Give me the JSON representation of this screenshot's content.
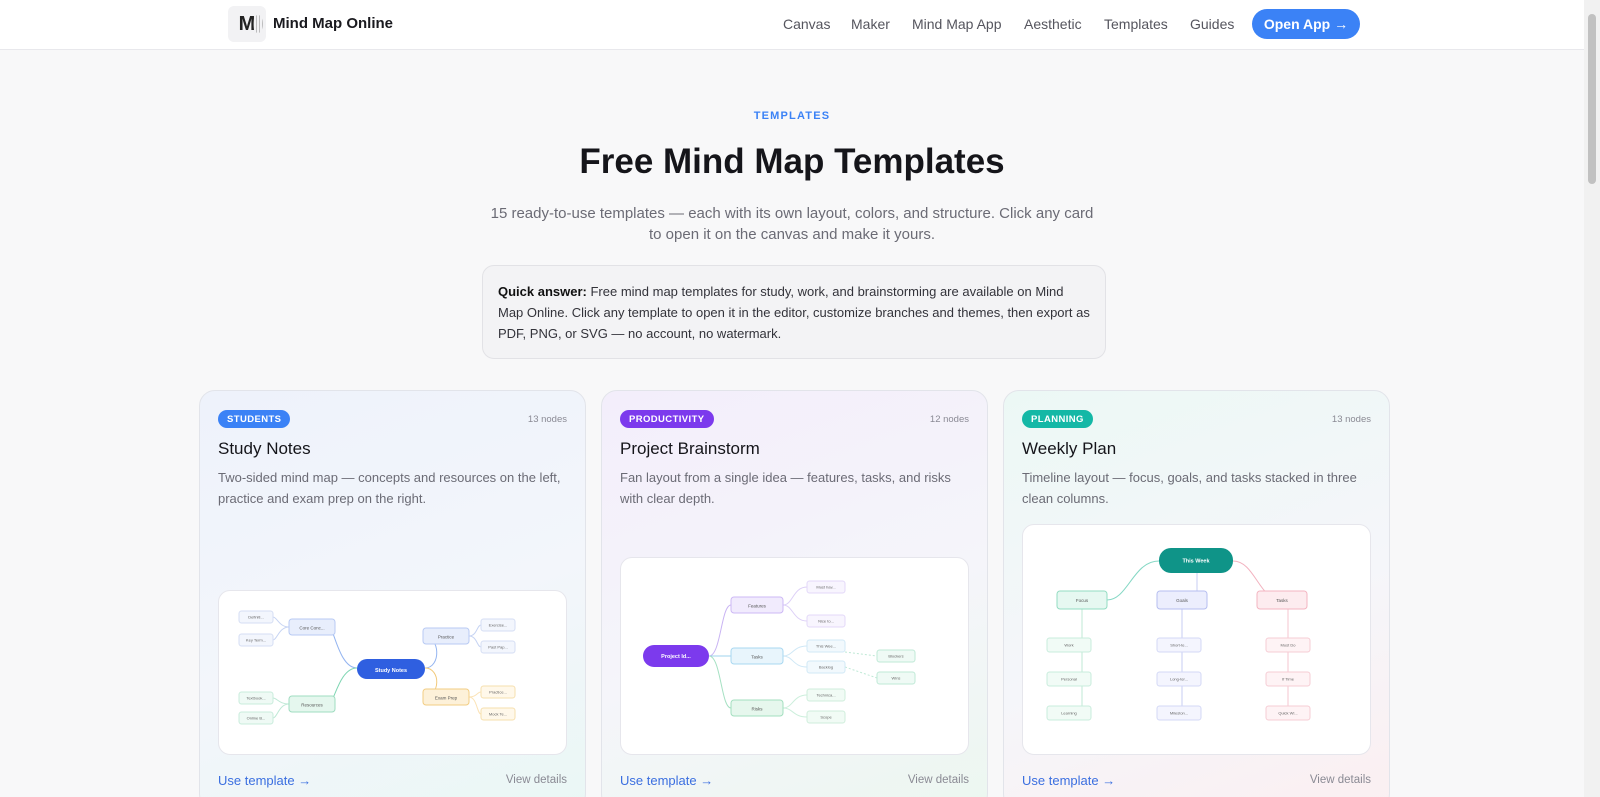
{
  "brand": {
    "logo_letter": "M",
    "name": "Mind Map Online"
  },
  "nav": {
    "links": [
      "Canvas",
      "Maker",
      "Mind Map App",
      "Aesthetic",
      "Templates",
      "Guides"
    ],
    "cta": "Open App →"
  },
  "hero": {
    "eyebrow": "TEMPLATES",
    "title": "Free Mind Map Templates",
    "subtitle": "15 ready-to-use templates — each with its own layout, colors, and structure. Click any card to open it on the canvas and make it yours."
  },
  "quick_answer": {
    "label": "Quick answer:",
    "text": " Free mind map templates for study, work, and brainstorming are available on Mind Map Online. Click any template to open it in the editor, customize branches and themes, then export as PDF, PNG, or SVG — no account, no watermark."
  },
  "cards": [
    {
      "badge": "STUDENTS",
      "badge_color": "#3b82f6",
      "nodes": "13 nodes",
      "title": "Study Notes",
      "desc": "Two-sided mind map — concepts and resources on the left, practice and exam prep on the right.",
      "use": "Use template →",
      "details": "View details",
      "preview": {
        "center": "Study Notes",
        "branches": [
          "Core Conc...",
          "Practice",
          "Resources",
          "Exam Prep"
        ],
        "leaves": [
          "Definiti...",
          "Key Term...",
          "Exercise...",
          "Past Pap...",
          "Textbook...",
          "Online B...",
          "Practice...",
          "Mock Te..."
        ]
      }
    },
    {
      "badge": "PRODUCTIVITY",
      "badge_color": "#7c3aed",
      "nodes": "12 nodes",
      "title": "Project Brainstorm",
      "desc": "Fan layout from a single idea — features, tasks, and risks with clear depth.",
      "use": "Use template →",
      "details": "View details",
      "preview": {
        "center": "Project Id...",
        "branches": [
          "Features",
          "Tasks",
          "Risks"
        ],
        "leaves": [
          "Must hav...",
          "Nice to...",
          "This Wee...",
          "Backlog",
          "Technica...",
          "Scope",
          "Blockers",
          "Wins"
        ]
      }
    },
    {
      "badge": "PLANNING",
      "badge_color": "#14b8a6",
      "nodes": "13 nodes",
      "title": "Weekly Plan",
      "desc": "Timeline layout — focus, goals, and tasks stacked in three clean columns.",
      "use": "Use template →",
      "details": "View details",
      "preview": {
        "center": "This Week",
        "branches": [
          "Focus",
          "Goals",
          "Tasks"
        ],
        "leaves": [
          "Work",
          "Personal",
          "Learning",
          "Short-te...",
          "Long-ter...",
          "Mileston...",
          "Must Do",
          "If Time",
          "Quick Wi..."
        ]
      }
    }
  ]
}
